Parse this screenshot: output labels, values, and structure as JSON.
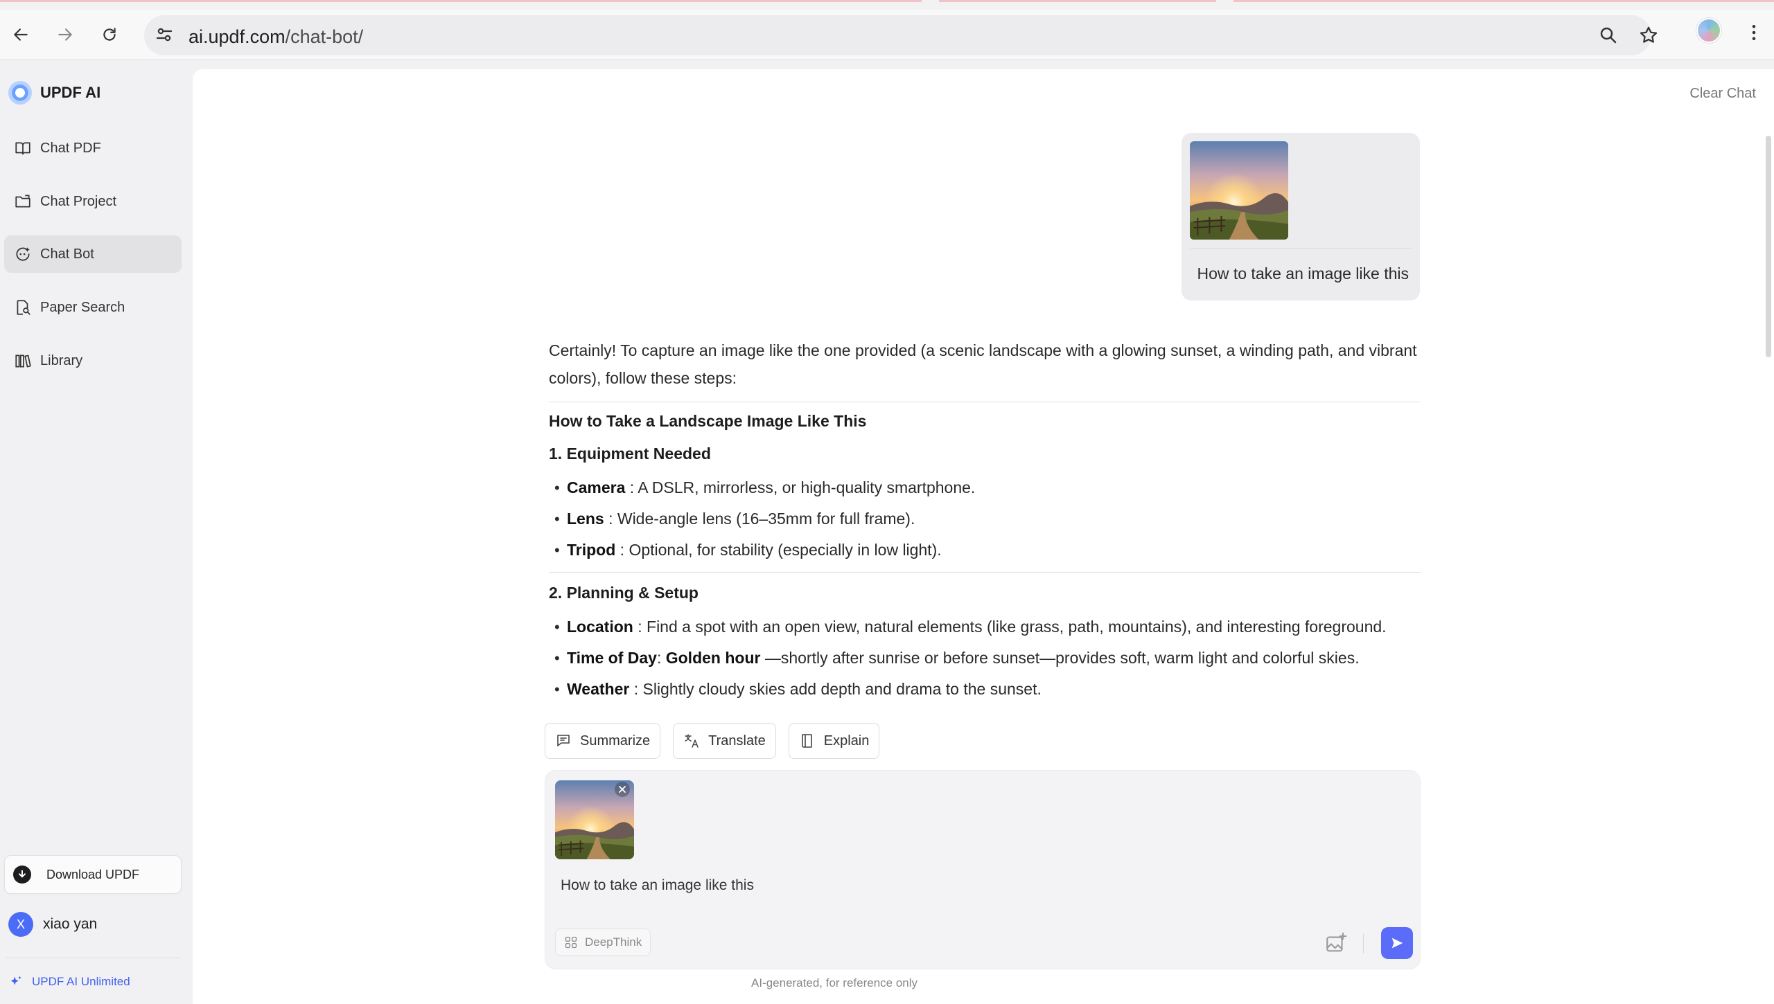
{
  "browser": {
    "url_host": "ai.updf.com",
    "url_path": "/chat-bot/"
  },
  "sidebar": {
    "brand": "UPDF AI",
    "items": [
      {
        "label": "Chat PDF",
        "icon": "book-icon"
      },
      {
        "label": "Chat Project",
        "icon": "folder-icon"
      },
      {
        "label": "Chat Bot",
        "icon": "bot-icon",
        "active": true
      },
      {
        "label": "Paper Search",
        "icon": "doc-search-icon"
      },
      {
        "label": "Library",
        "icon": "library-icon"
      }
    ],
    "download_label": "Download UPDF",
    "user_initial": "X",
    "user_name": "xiao yan",
    "plan_label": "UPDF AI Unlimited"
  },
  "main": {
    "clear_chat": "Clear Chat",
    "user_message": "How to take an image like this",
    "answer": {
      "intro": "Certainly! To capture an image like the one provided (a scenic landscape with a glowing sunset, a winding path, and vibrant colors), follow these steps:",
      "heading": "How to Take a Landscape Image Like This",
      "section1": {
        "title": "1. Equipment Needed",
        "items": [
          {
            "term": "Camera",
            "text": " : A DSLR, mirrorless, or high-quality smartphone."
          },
          {
            "term": "Lens",
            "text": " : Wide-angle lens (16–35mm for full frame)."
          },
          {
            "term": "Tripod",
            "text": " : Optional, for stability (especially in low light)."
          }
        ]
      },
      "section2": {
        "title": "2. Planning & Setup",
        "items": [
          {
            "term": "Location",
            "text": " : Find a spot with an open view, natural elements (like grass, path, mountains), and interesting foreground."
          },
          {
            "term": "Time of Day",
            "term2": "Golden hour",
            "sep": ": ",
            "text": " —shortly after sunrise or before sunset—provides soft, warm light and colorful skies."
          },
          {
            "term": "Weather",
            "text": " : Slightly cloudy skies add depth and drama to the sunset."
          }
        ]
      }
    },
    "actions": {
      "summarize": "Summarize",
      "translate": "Translate",
      "explain": "Explain"
    },
    "composer": {
      "input_value": "How to take an image like this",
      "deepthink": "DeepThink"
    },
    "footer_note": "AI-generated, for reference only"
  },
  "colors": {
    "accent": "#5b6cf9",
    "plan_text": "#4361ee",
    "active_nav": "#e2e2e5"
  }
}
